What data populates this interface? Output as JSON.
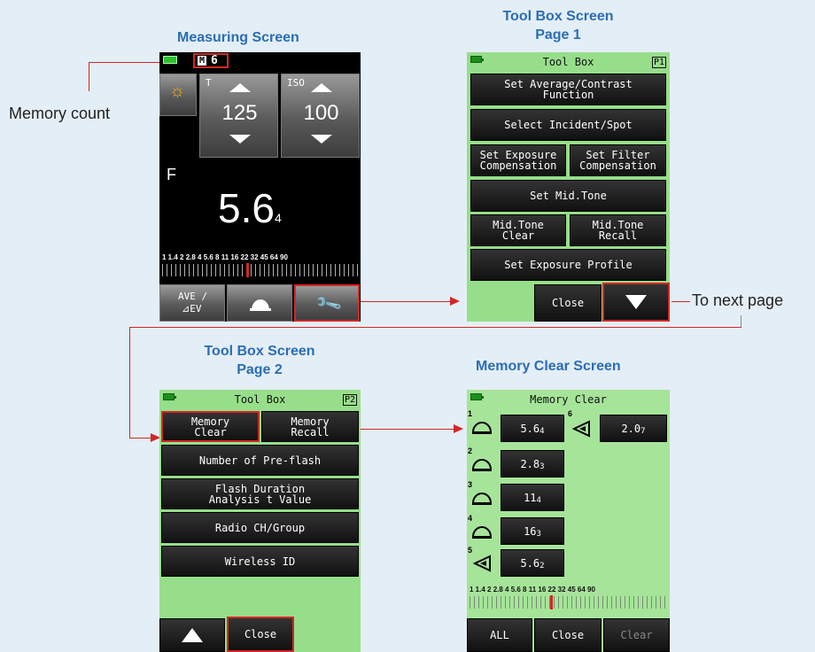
{
  "titles": {
    "measuring": "Measuring Screen",
    "toolbox1_l1": "Tool Box Screen",
    "toolbox1_l2": "Page 1",
    "toolbox2_l1": "Tool Box Screen",
    "toolbox2_l2": "Page 2",
    "memclear": "Memory Clear Screen"
  },
  "callouts": {
    "memory_count": "Memory count",
    "next_page": "To next page"
  },
  "measuring": {
    "memory_badge": "M",
    "memory_value": "6",
    "t_label": "T",
    "t_value": "125",
    "iso_label": "ISO",
    "iso_value": "100",
    "f_label": "F",
    "f_main": "5.",
    "f_big": "6",
    "f_sub": "4",
    "scale_labels": "1  1.4  2  2.8  4  5.6  8  11  16  22  32  45  64  90",
    "btn_ave": "AVE /",
    "btn_ev": "⊿EV"
  },
  "toolbox1": {
    "title": "Tool Box",
    "page": "P1",
    "items": [
      "Set Average/Contrast\nFunction",
      "Select Incident/Spot",
      "Set Exposure\nCompensation",
      "Set Filter\nCompensation",
      "Set Mid.Tone",
      "Mid.Tone\nClear",
      "Mid.Tone\nRecall",
      "Set Exposure Profile"
    ],
    "close": "Close"
  },
  "toolbox2": {
    "title": "Tool Box",
    "page": "P2",
    "items": [
      "Memory\nClear",
      "Memory\nRecall",
      "Number of Pre-flash",
      "Flash Duration\nAnalysis t Value",
      "Radio CH/Group",
      "Wireless ID"
    ],
    "close": "Close"
  },
  "memclear": {
    "title": "Memory Clear",
    "rows": [
      {
        "n": "1",
        "main": "5.6",
        "sub": "4"
      },
      {
        "n": "2",
        "main": "2.8",
        "sub": "3"
      },
      {
        "n": "3",
        "main": "11",
        "sub": "4"
      },
      {
        "n": "4",
        "main": "16",
        "sub": "3"
      },
      {
        "n": "5",
        "main": "5.6",
        "sub": "2"
      },
      {
        "n": "6",
        "main": "2.0",
        "sub": "7"
      }
    ],
    "scale_labels": "1  1.4  2  2.8  4  5.6  8  11  16  22  32  45  64  90",
    "btn_all": "ALL",
    "btn_close": "Close",
    "btn_clear": "Clear"
  },
  "colors": {
    "title_blue": "#2a6db5",
    "screen_green": "#97de8a",
    "accent_red": "#d42626",
    "background": "#e4eef6"
  }
}
